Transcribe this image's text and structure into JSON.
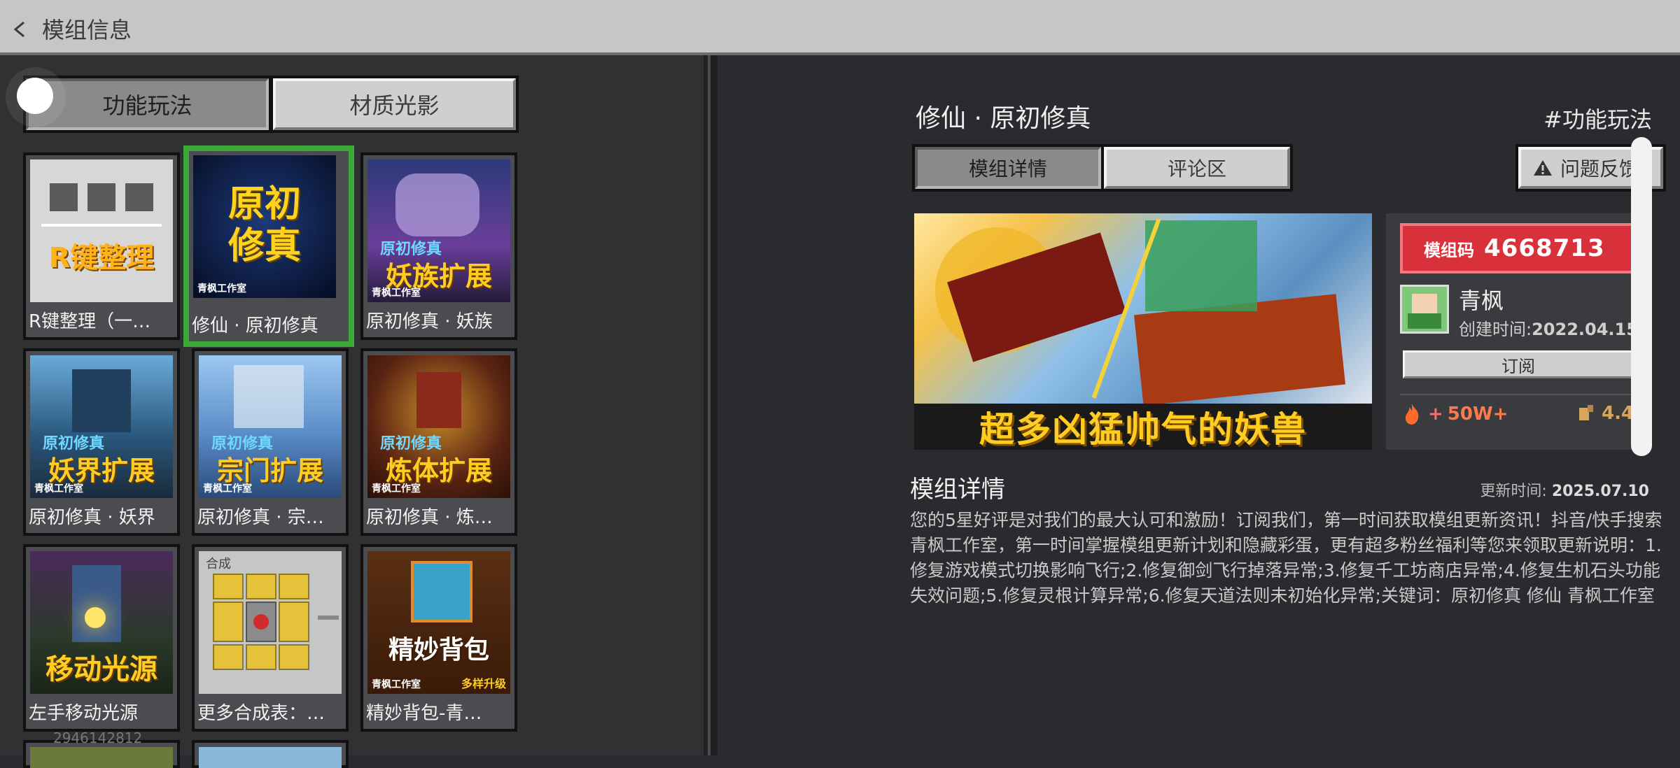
{
  "header": {
    "title": "模组信息"
  },
  "left": {
    "tabs": [
      {
        "label": "功能玩法",
        "active": true
      },
      {
        "label": "材质光影",
        "active": false
      }
    ],
    "cards": [
      {
        "name": "R键整理（一…",
        "thumb_text": "R键整理",
        "bg": "#d7d7d7"
      },
      {
        "name": "修仙 · 原初修真",
        "thumb_text": "原初修真",
        "studio": "青枫工作室",
        "bg": "#0e1a3a",
        "selected": true
      },
      {
        "name": "原初修真 · 妖族",
        "thumb_text": "妖族扩展",
        "sub": "原初修真",
        "studio": "青枫工作室",
        "bg": "#3a2d6a"
      },
      {
        "name": "原初修真 · 妖界",
        "thumb_text": "妖界扩展",
        "sub": "原初修真",
        "studio": "青枫工作室",
        "bg": "#1d4060"
      },
      {
        "name": "原初修真 · 宗…",
        "thumb_text": "宗门扩展",
        "sub": "原初修真",
        "studio": "青枫工作室",
        "bg": "#4a78b8"
      },
      {
        "name": "原初修真 · 炼…",
        "thumb_text": "炼体扩展",
        "sub": "原初修真",
        "studio": "青枫工作室",
        "bg": "#5a2a18"
      },
      {
        "name": "左手移动光源",
        "thumb_text": "移动光源",
        "bg": "#2a3a2a"
      },
      {
        "name": "更多合成表：…",
        "thumb_text": "合成",
        "bg": "#c6c6c6"
      },
      {
        "name": "精妙背包-青…",
        "thumb_text": "精妙背包",
        "sub": "多样升级",
        "studio": "青枫工作室",
        "bg": "#4a2a12"
      }
    ],
    "watermark": "2946142812"
  },
  "mod": {
    "title": "修仙 · 原初修真",
    "category": "#功能玩法",
    "tabs": [
      {
        "label": "模组详情",
        "active": true
      },
      {
        "label": "评论区",
        "active": false
      }
    ],
    "feedback_label": "问题反馈",
    "banner_caption": "超多凶猛帅气的妖兽",
    "code_label": "模组码",
    "code_value": "4668713",
    "author": "青枫",
    "created_label": "创建时间:",
    "created_value": "2022.04.15",
    "subscribe_label": "订阅",
    "downloads": "50W+",
    "rating": "4.4",
    "detail_heading": "模组详情",
    "update_label": "更新时间:",
    "update_value": "2025.07.10",
    "description": "您的5星好评是对我们的最大认可和激励！订阅我们，第一时间获取模组更新资讯！抖音/快手搜索青枫工作室，第一时间掌握模组更新计划和隐藏彩蛋，更有超多粉丝福利等您来领取更新说明：1.修复游戏模式切换影响飞行;2.修复御剑飞行掉落异常;3.修复千工坊商店异常;4.修复生机石头功能失效问题;5.修复灵根计算异常;6.修复天道法则未初始化异常;关键词：原初修真 修仙 青枫工作室"
  }
}
